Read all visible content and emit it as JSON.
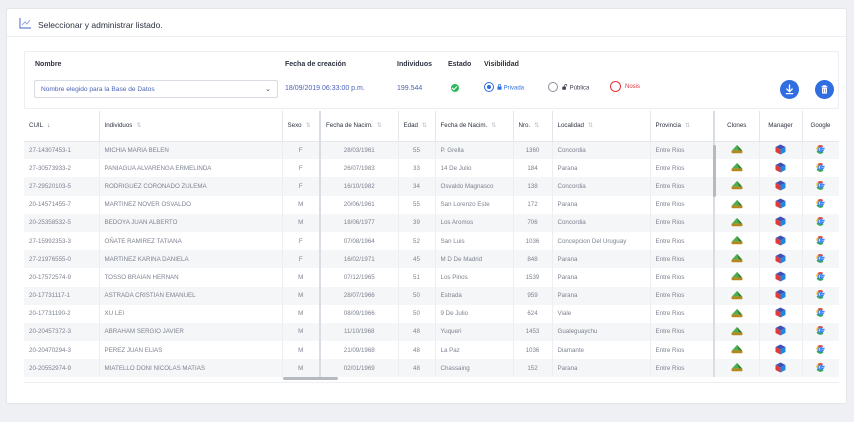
{
  "header": {
    "title": "Seleccionar y administrar listado."
  },
  "filters": {
    "nombre_label": "Nombre",
    "nombre_value": "Nombre elegido para la Base de Datos",
    "fecha_label": "Fecha de creación",
    "fecha_value": "18/09/2019 06:33:00 p.m.",
    "individuos_label": "Individuos",
    "individuos_value": "199.544",
    "estado_label": "Estado",
    "visibilidad_label": "Visibilidad",
    "vis_options": {
      "privada": "Privada",
      "publica": "Pública",
      "nosis": "Nosis"
    },
    "selected_visibility": "privada"
  },
  "colors": {
    "accent": "#2f6de0",
    "ok": "#2eb85c",
    "nosis": "#e0353a",
    "value_text": "#4b63b8"
  },
  "table": {
    "columns": [
      "CUIL",
      "Individuos",
      "Sexo",
      "Fecha de Nacim.",
      "Edad",
      "Fecha de Nacim.",
      "Nro.",
      "Localidad",
      "Provincia",
      "Clones",
      "Manager",
      "Google"
    ],
    "rows": [
      [
        "27-14307453-1",
        "MICHIA MARIA BELEN",
        "F",
        "28/03/1961",
        "55",
        "P. Grella",
        "1360",
        "Concordia",
        "Entre Rios"
      ],
      [
        "27-30573933-2",
        "PANIAGUA ALVARENGA ERMELINDA",
        "F",
        "26/07/1983",
        "33",
        "14 De Julio",
        "184",
        "Parana",
        "Entre Rios"
      ],
      [
        "27-29520103-5",
        "RODRIGUEZ CORONADO ZULEMA",
        "F",
        "16/10/1982",
        "34",
        "Osvaldo Magnasco",
        "138",
        "Concordia",
        "Entre Rios"
      ],
      [
        "20-14571455-7",
        "MARTINEZ NOVER OSVALDO",
        "M",
        "20/06/1961",
        "55",
        "San Lorenzo Este",
        "172",
        "Parana",
        "Entre Rios"
      ],
      [
        "20-25358532-5",
        "BEDOYA JUAN ALBERTO",
        "M",
        "18/06/1977",
        "39",
        "Los Aromos",
        "706",
        "Concordia",
        "Entre Rios"
      ],
      [
        "27-15992353-3",
        "OÑATE RAMIREZ TATIANA",
        "F",
        "07/08/1964",
        "52",
        "San Luis",
        "1036",
        "Concepcion Del Uruguay",
        "Entre Rios"
      ],
      [
        "27-21976555-0",
        "MARTINEZ KARINA DANIELA",
        "F",
        "16/02/1971",
        "45",
        "M D De Madrid",
        "848",
        "Parana",
        "Entre Rios"
      ],
      [
        "20-17572574-9",
        "TOSSO BRAIAN HERNAN",
        "M",
        "07/12/1965",
        "51",
        "Los Pinos",
        "1539",
        "Parana",
        "Entre Rios"
      ],
      [
        "20-17731117-1",
        "ASTRADA CRISTIAN EMANUEL",
        "M",
        "28/07/1966",
        "50",
        "Estrada",
        "959",
        "Parana",
        "Entre Rios"
      ],
      [
        "20-17731190-2",
        "XU LEI",
        "M",
        "08/09/1966",
        "50",
        "9 De Julio",
        "624",
        "Viale",
        "Entre Rios"
      ],
      [
        "20-20457372-3",
        "ABRAHAM SERGIO JAVIER",
        "M",
        "11/10/1968",
        "48",
        "Yuqueri",
        "1453",
        "Gualeguaychu",
        "Entre Rios"
      ],
      [
        "20-20470294-3",
        "PEREZ JUAN ELIAS",
        "M",
        "21/09/1968",
        "48",
        "La Paz",
        "1036",
        "Diamante",
        "Entre Rios"
      ],
      [
        "20-20552974-9",
        "MIATELLO DONI NICOLAS MATIAS",
        "M",
        "02/01/1969",
        "48",
        "Chassaing",
        "152",
        "Parana",
        "Entre Rios"
      ]
    ],
    "icons": {
      "clones": "sheep-clone-icon",
      "manager": "manager-cube-icon",
      "google": "google-g-icon"
    }
  }
}
